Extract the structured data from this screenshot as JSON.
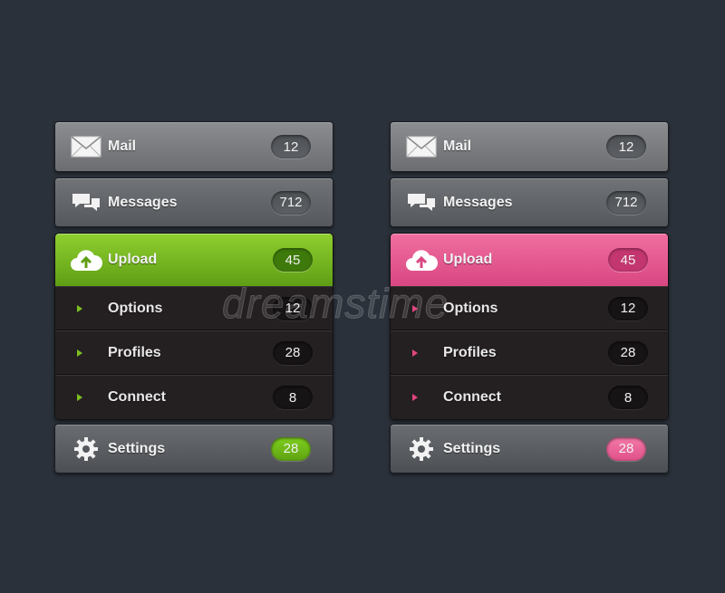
{
  "menus": [
    {
      "accent": "#7cc21f",
      "mail": {
        "label": "Mail",
        "count": "12",
        "icon": "mail-icon"
      },
      "messages": {
        "label": "Messages",
        "count": "712",
        "icon": "chat-bubbles-icon"
      },
      "upload": {
        "label": "Upload",
        "count": "45",
        "icon": "cloud-upload-icon"
      },
      "subitems": [
        {
          "label": "Options",
          "count": "12"
        },
        {
          "label": "Profiles",
          "count": "28"
        },
        {
          "label": "Connect",
          "count": "8"
        }
      ],
      "settings": {
        "label": "Settings",
        "count": "28",
        "icon": "gear-icon"
      }
    },
    {
      "accent": "#e0457e",
      "mail": {
        "label": "Mail",
        "count": "12",
        "icon": "mail-icon"
      },
      "messages": {
        "label": "Messages",
        "count": "712",
        "icon": "chat-bubbles-icon"
      },
      "upload": {
        "label": "Upload",
        "count": "45",
        "icon": "cloud-upload-icon"
      },
      "subitems": [
        {
          "label": "Options",
          "count": "12"
        },
        {
          "label": "Profiles",
          "count": "28"
        },
        {
          "label": "Connect",
          "count": "8"
        }
      ],
      "settings": {
        "label": "Settings",
        "count": "28",
        "icon": "gear-icon"
      }
    }
  ],
  "watermark": "dreamstime"
}
